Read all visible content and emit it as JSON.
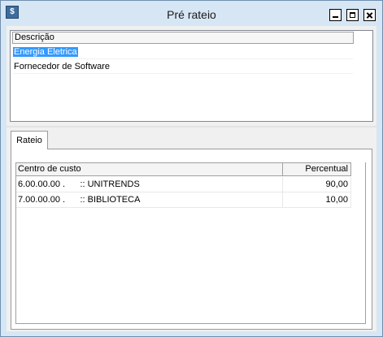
{
  "window": {
    "title": "Pré rateio",
    "icon": "app-icon"
  },
  "descricao": {
    "header": "Descrição",
    "items": [
      {
        "label": "Energia Eletrica",
        "selected": true
      },
      {
        "label": "Fornecedor de Software",
        "selected": false
      }
    ]
  },
  "tabs": [
    {
      "label": "Rateio"
    }
  ],
  "rateio": {
    "columns": [
      "Centro de custo",
      "Percentual"
    ],
    "rows": [
      {
        "centro": "6.00.00.00 .      :: UNITRENDS",
        "percentual": "90,00"
      },
      {
        "centro": "7.00.00.00 .      :: BIBLIOTECA",
        "percentual": "10,00"
      }
    ]
  },
  "colors": {
    "selection": "#3399ff",
    "titlebar": "#d6e6f4"
  }
}
